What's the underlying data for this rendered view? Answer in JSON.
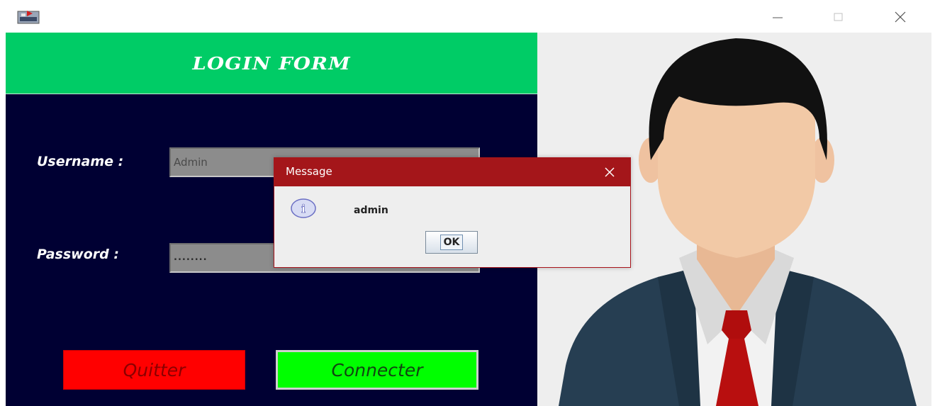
{
  "window": {
    "app_icon": "java-app-icon",
    "minimize_icon": "minimize-icon",
    "maximize_icon": "maximize-icon",
    "close_icon": "close-icon"
  },
  "form": {
    "title": "LOGIN FORM",
    "username_label": "Username :",
    "username_value": "Admin",
    "password_label": "Password :",
    "password_value": "........",
    "quit_label": "Quitter",
    "connect_label": "Connecter"
  },
  "illustration": "businessman-avatar",
  "dialog": {
    "title": "Message",
    "message": "admin",
    "ok_label": "OK",
    "icon": "info-icon"
  },
  "colors": {
    "header_green": "#00cc66",
    "panel_navy": "#000033",
    "quit_red": "#ff0000",
    "connect_green": "#00ff00",
    "dialog_title_red": "#a4161a"
  }
}
